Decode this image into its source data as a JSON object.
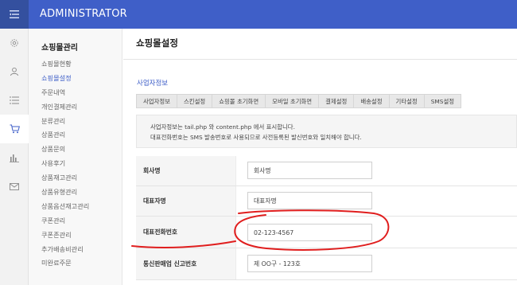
{
  "app": {
    "title": "ADMINISTRATOR"
  },
  "colors": {
    "brand": "#3f5fc8",
    "annotation": "#e01e1e"
  },
  "icon_bar": [
    {
      "name": "gear-icon"
    },
    {
      "name": "person-icon"
    },
    {
      "name": "list-icon"
    },
    {
      "name": "cart-icon"
    },
    {
      "name": "bar-chart-icon"
    },
    {
      "name": "mail-icon"
    }
  ],
  "sidebar": {
    "title": "쇼핑몰관리",
    "items": [
      {
        "label": "쇼핑몰현황",
        "active": false
      },
      {
        "label": "쇼핑몰설정",
        "active": true
      },
      {
        "label": "주문내역",
        "active": false
      },
      {
        "label": "개인결제관리",
        "active": false
      },
      {
        "label": "분류관리",
        "active": false
      },
      {
        "label": "상품관리",
        "active": false
      },
      {
        "label": "상품문의",
        "active": false
      },
      {
        "label": "사용후기",
        "active": false
      },
      {
        "label": "상품재고관리",
        "active": false
      },
      {
        "label": "상품유형관리",
        "active": false
      },
      {
        "label": "상품옵션재고관리",
        "active": false
      },
      {
        "label": "쿠폰관리",
        "active": false
      },
      {
        "label": "쿠폰존관리",
        "active": false
      },
      {
        "label": "추가배송비관리",
        "active": false
      },
      {
        "label": "미완료주문",
        "active": false
      }
    ]
  },
  "main": {
    "page_title": "쇼핑몰설정",
    "section_title": "사업자정보",
    "tabs": [
      {
        "label": "사업자정보"
      },
      {
        "label": "스킨설정"
      },
      {
        "label": "쇼핑몰 초기화면"
      },
      {
        "label": "모바일 초기화면"
      },
      {
        "label": "결제설정"
      },
      {
        "label": "배송설정"
      },
      {
        "label": "기타설정"
      },
      {
        "label": "SMS설정"
      }
    ],
    "notice": {
      "line1": "사업자정보는 tail.php 와 content.php 에서 표시합니다.",
      "line2": "대표전화번호는 SMS 발송번호로 사용되므로 사전등록된 발신번호와 일치해야 합니다."
    },
    "fields": {
      "company_name": {
        "label": "회사명",
        "value": "회사명"
      },
      "ceo_name": {
        "label": "대표자명",
        "value": "대표자명"
      },
      "phone": {
        "label": "대표전화번호",
        "value": "02-123-4567"
      },
      "mail_order_no": {
        "label": "통신판매업 신고번호",
        "value": "제 OO구 - 123호"
      }
    }
  }
}
